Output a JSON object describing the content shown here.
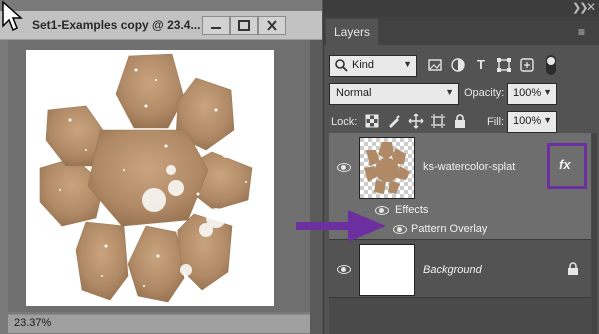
{
  "document": {
    "title": "Set1-Examples copy @ 23.4...",
    "zoom": "23.37%",
    "window_buttons": {
      "minimize_icon": "minimize-icon",
      "maximize_icon": "maximize-icon",
      "close_icon": "close-icon"
    }
  },
  "layers_panel": {
    "tab_label": "Layers",
    "collapse_icon": "double-chevron-right-icon",
    "close_icon": "close-icon",
    "menu_icon": "panel-menu-icon",
    "filter": {
      "kind_label": "Kind",
      "icons": [
        "pixel-layer-filter-icon",
        "adjustment-layer-filter-icon",
        "type-layer-filter-icon",
        "shape-layer-filter-icon",
        "smart-object-filter-icon"
      ]
    },
    "blend_mode": "Normal",
    "opacity_label": "Opacity:",
    "opacity_value": "100%",
    "lock_label": "Lock:",
    "lock_icons": [
      "lock-transparent-pixels-icon",
      "lock-image-pixels-icon",
      "lock-position-icon",
      "lock-artboard-icon",
      "lock-all-icon"
    ],
    "fill_label": "Fill:",
    "fill_value": "100%",
    "layers": [
      {
        "name": "ks-watercolor-splat",
        "fx_label": "fx",
        "effects_label": "Effects",
        "effect": "Pattern Overlay"
      },
      {
        "name": "Background"
      }
    ]
  },
  "colors": {
    "annotation_purple": "#6b2fa0",
    "selected_layer_bg": "#6e6e6e",
    "panel_bg": "#535353",
    "splat_brown": "#b08a66"
  }
}
